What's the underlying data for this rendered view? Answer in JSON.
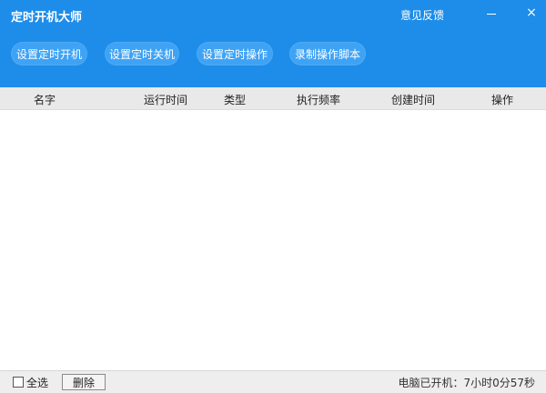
{
  "app": {
    "title": "定时开机大师",
    "feedback": "意见反馈"
  },
  "window": {
    "close_glyph": "×"
  },
  "toolbar": {
    "buttons": [
      {
        "label": "设置定时开机"
      },
      {
        "label": "设置定时关机"
      },
      {
        "label": "设置定时操作"
      },
      {
        "label": "录制操作脚本"
      }
    ]
  },
  "table": {
    "columns": [
      "名字",
      "运行时间",
      "类型",
      "执行频率",
      "创建时间",
      "操作"
    ],
    "rows": []
  },
  "footer": {
    "select_all": "全选",
    "delete": "删除",
    "uptime": "电脑已开机：7小时0分57秒"
  },
  "colors": {
    "header": "#1e8de9",
    "button": "#3fa3f5"
  },
  "icons": {
    "minimize": "minimize-icon",
    "close": "close-icon",
    "checkbox": "checkbox-icon"
  }
}
